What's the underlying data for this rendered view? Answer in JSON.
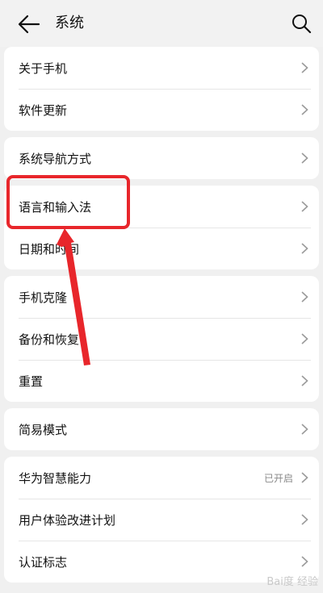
{
  "header": {
    "title": "系统"
  },
  "groups": [
    {
      "items": [
        {
          "label": "关于手机"
        },
        {
          "label": "软件更新"
        }
      ]
    },
    {
      "items": [
        {
          "label": "系统导航方式"
        }
      ]
    },
    {
      "items": [
        {
          "label": "语言和输入法"
        },
        {
          "label": "日期和时间"
        }
      ]
    },
    {
      "items": [
        {
          "label": "手机克隆"
        },
        {
          "label": "备份和恢复"
        },
        {
          "label": "重置"
        }
      ]
    },
    {
      "items": [
        {
          "label": "简易模式"
        }
      ]
    },
    {
      "items": [
        {
          "label": "华为智慧能力",
          "status": "已开启"
        },
        {
          "label": "用户体验改进计划"
        },
        {
          "label": "认证标志"
        }
      ]
    }
  ],
  "watermark": "Bai度 经验",
  "colors": {
    "annotation": "#e8262b",
    "background": "#f0f0f0",
    "card": "#ffffff"
  },
  "icons": {
    "back": "arrow-left-icon",
    "search": "search-icon",
    "row_chevron": "chevron-right-icon"
  }
}
